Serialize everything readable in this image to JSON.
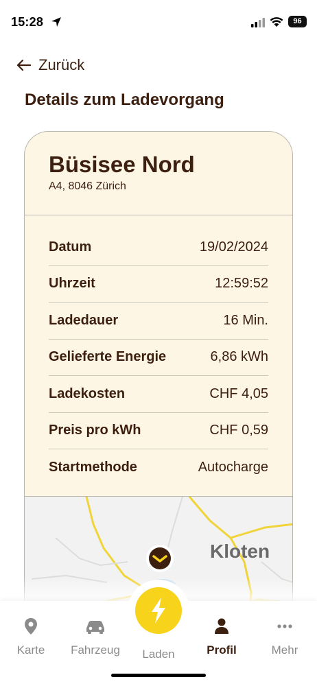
{
  "status_bar": {
    "time": "15:28",
    "battery": "96"
  },
  "header": {
    "back_label": "Zurück",
    "title": "Details zum Ladevorgang"
  },
  "station": {
    "name": "Büsisee Nord",
    "address": "A4, 8046 Zürich"
  },
  "details": [
    {
      "label": "Datum",
      "value": "19/02/2024"
    },
    {
      "label": "Uhrzeit",
      "value": "12:59:52"
    },
    {
      "label": "Ladedauer",
      "value": "16 Min."
    },
    {
      "label": "Gelieferte Energie",
      "value": "6,86 kWh"
    },
    {
      "label": "Ladekosten",
      "value": "CHF 4,05"
    },
    {
      "label": "Preis pro kWh",
      "value": "CHF 0,59"
    },
    {
      "label": "Startmethode",
      "value": "Autocharge"
    }
  ],
  "map": {
    "city_label": "Kloten"
  },
  "tabbar": {
    "items": [
      {
        "label": "Karte",
        "icon": "map-pin-icon",
        "active": false
      },
      {
        "label": "Fahrzeug",
        "icon": "car-icon",
        "active": false
      },
      {
        "label": "Laden",
        "icon": "lightning-icon",
        "active": false
      },
      {
        "label": "Profil",
        "icon": "person-icon",
        "active": true
      },
      {
        "label": "Mehr",
        "icon": "more-dots-icon",
        "active": false
      }
    ]
  },
  "colors": {
    "brand_brown": "#3d1f0f",
    "card_bg": "#fdf6e4",
    "accent_yellow": "#f7d31b",
    "inactive_gray": "#8b8b8b"
  }
}
